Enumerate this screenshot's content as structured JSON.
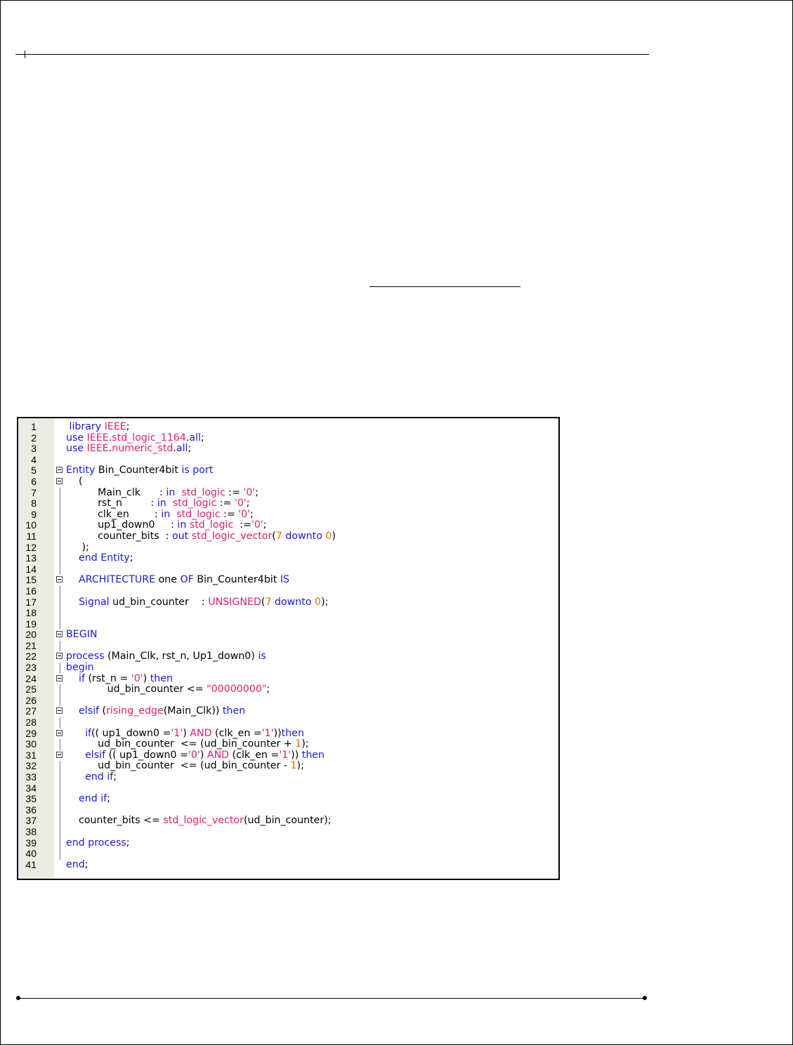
{
  "code_editor": {
    "lines": [
      {
        "n": "1",
        "fold": "",
        "tokens": [
          [
            "t",
            " "
          ],
          [
            "kw",
            "library"
          ],
          [
            "t",
            " "
          ],
          [
            "ty",
            "IEEE"
          ],
          [
            "t",
            ";"
          ]
        ]
      },
      {
        "n": "2",
        "fold": "",
        "tokens": [
          [
            "kw",
            "use"
          ],
          [
            "t",
            " "
          ],
          [
            "ty",
            "IEEE"
          ],
          [
            "t",
            "."
          ],
          [
            "ty",
            "std_logic_1164"
          ],
          [
            "t",
            "."
          ],
          [
            "kw",
            "all"
          ],
          [
            "t",
            ";"
          ]
        ]
      },
      {
        "n": "3",
        "fold": "",
        "tokens": [
          [
            "kw",
            "use"
          ],
          [
            "t",
            " "
          ],
          [
            "ty",
            "IEEE"
          ],
          [
            "t",
            "."
          ],
          [
            "ty",
            "numeric_std"
          ],
          [
            "t",
            "."
          ],
          [
            "kw",
            "all"
          ],
          [
            "t",
            ";"
          ]
        ]
      },
      {
        "n": "4",
        "fold": "",
        "tokens": []
      },
      {
        "n": "5",
        "fold": "box",
        "tokens": [
          [
            "kw",
            "Entity"
          ],
          [
            "t",
            " Bin_Counter4bit "
          ],
          [
            "kw",
            "is"
          ],
          [
            "t",
            " "
          ],
          [
            "kw",
            "port"
          ]
        ]
      },
      {
        "n": "6",
        "fold": "box",
        "tokens": [
          [
            "t",
            "    ("
          ]
        ]
      },
      {
        "n": "7",
        "fold": "bar",
        "tokens": [
          [
            "t",
            "          Main_clk      : "
          ],
          [
            "kw",
            "in"
          ],
          [
            "t",
            "  "
          ],
          [
            "ty",
            "std_logic"
          ],
          [
            "t",
            " := "
          ],
          [
            "str",
            "'0'"
          ],
          [
            "t",
            ";"
          ]
        ]
      },
      {
        "n": "8",
        "fold": "bar",
        "tokens": [
          [
            "t",
            "          rst_n         : "
          ],
          [
            "kw",
            "in"
          ],
          [
            "t",
            "  "
          ],
          [
            "ty",
            "std_logic"
          ],
          [
            "t",
            " := "
          ],
          [
            "str",
            "'0'"
          ],
          [
            "t",
            ";"
          ]
        ]
      },
      {
        "n": "9",
        "fold": "bar",
        "tokens": [
          [
            "t",
            "          clk_en        : "
          ],
          [
            "kw",
            "in"
          ],
          [
            "t",
            "  "
          ],
          [
            "ty",
            "std_logic"
          ],
          [
            "t",
            " := "
          ],
          [
            "str",
            "'0'"
          ],
          [
            "t",
            ";"
          ]
        ]
      },
      {
        "n": "10",
        "fold": "bar",
        "tokens": [
          [
            "t",
            "          up1_down0     : "
          ],
          [
            "kw",
            "in"
          ],
          [
            "t",
            " "
          ],
          [
            "ty",
            "std_logic"
          ],
          [
            "t",
            "  :="
          ],
          [
            "str",
            "'0'"
          ],
          [
            "t",
            ";"
          ]
        ]
      },
      {
        "n": "11",
        "fold": "bar",
        "tokens": [
          [
            "t",
            "          counter_bits  : "
          ],
          [
            "kw",
            "out"
          ],
          [
            "t",
            " "
          ],
          [
            "ty",
            "std_logic_vector"
          ],
          [
            "t",
            "("
          ],
          [
            "num",
            "7"
          ],
          [
            "t",
            " "
          ],
          [
            "kw",
            "downto"
          ],
          [
            "t",
            " "
          ],
          [
            "num",
            "0"
          ],
          [
            "t",
            ")"
          ]
        ]
      },
      {
        "n": "12",
        "fold": "bar",
        "tokens": [
          [
            "t",
            "     );"
          ]
        ]
      },
      {
        "n": "13",
        "fold": "bar",
        "tokens": [
          [
            "t",
            "    "
          ],
          [
            "kw",
            "end"
          ],
          [
            "t",
            " "
          ],
          [
            "kw",
            "Entity"
          ],
          [
            "t",
            ";"
          ]
        ]
      },
      {
        "n": "14",
        "fold": "bar",
        "tokens": []
      },
      {
        "n": "15",
        "fold": "box",
        "tokens": [
          [
            "t",
            "    "
          ],
          [
            "kw",
            "ARCHITECTURE"
          ],
          [
            "t",
            " one "
          ],
          [
            "kw",
            "OF"
          ],
          [
            "t",
            " Bin_Counter4bit "
          ],
          [
            "kw",
            "IS"
          ]
        ]
      },
      {
        "n": "16",
        "fold": "bar",
        "tokens": []
      },
      {
        "n": "17",
        "fold": "bar",
        "tokens": [
          [
            "t",
            "    "
          ],
          [
            "kw",
            "Signal"
          ],
          [
            "t",
            " ud_bin_counter    : "
          ],
          [
            "ty",
            "UNSIGNED"
          ],
          [
            "t",
            "("
          ],
          [
            "num",
            "7"
          ],
          [
            "t",
            " "
          ],
          [
            "kw",
            "downto"
          ],
          [
            "t",
            " "
          ],
          [
            "num",
            "0"
          ],
          [
            "t",
            ");"
          ]
        ]
      },
      {
        "n": "18",
        "fold": "bar",
        "tokens": []
      },
      {
        "n": "19",
        "fold": "bar",
        "tokens": []
      },
      {
        "n": "20",
        "fold": "box",
        "tokens": [
          [
            "kw",
            "BEGIN"
          ]
        ]
      },
      {
        "n": "21",
        "fold": "bar",
        "tokens": []
      },
      {
        "n": "22",
        "fold": "box",
        "tokens": [
          [
            "kw",
            "process"
          ],
          [
            "t",
            " (Main_Clk, rst_n, Up1_down0) "
          ],
          [
            "kw",
            "is"
          ]
        ]
      },
      {
        "n": "23",
        "fold": "bar",
        "tokens": [
          [
            "kw",
            "begin"
          ]
        ]
      },
      {
        "n": "24",
        "fold": "box",
        "tokens": [
          [
            "t",
            "    "
          ],
          [
            "kw",
            "if"
          ],
          [
            "t",
            " (rst_n = "
          ],
          [
            "str",
            "'0'"
          ],
          [
            "t",
            ") "
          ],
          [
            "kw",
            "then"
          ]
        ]
      },
      {
        "n": "25",
        "fold": "bar",
        "tokens": [
          [
            "t",
            "             ud_bin_counter <= "
          ],
          [
            "str",
            "\"00000000\""
          ],
          [
            "t",
            ";"
          ]
        ]
      },
      {
        "n": "26",
        "fold": "bar",
        "tokens": []
      },
      {
        "n": "27",
        "fold": "box",
        "tokens": [
          [
            "t",
            "    "
          ],
          [
            "kw",
            "elsif"
          ],
          [
            "t",
            " ("
          ],
          [
            "ty",
            "rising_edge"
          ],
          [
            "t",
            "(Main_Clk)) "
          ],
          [
            "kw",
            "then"
          ]
        ]
      },
      {
        "n": "28",
        "fold": "bar",
        "tokens": []
      },
      {
        "n": "29",
        "fold": "box",
        "tokens": [
          [
            "t",
            "      "
          ],
          [
            "kw",
            "if"
          ],
          [
            "t",
            "(( up1_down0 ="
          ],
          [
            "str",
            "'1'"
          ],
          [
            "t",
            ") "
          ],
          [
            "ty",
            "AND"
          ],
          [
            "t",
            " (clk_en ="
          ],
          [
            "str",
            "'1'"
          ],
          [
            "t",
            "))"
          ],
          [
            "kw",
            "then"
          ]
        ]
      },
      {
        "n": "30",
        "fold": "bar",
        "tokens": [
          [
            "t",
            "          ud_bin_counter  <= (ud_bin_counter + "
          ],
          [
            "num",
            "1"
          ],
          [
            "t",
            ");"
          ]
        ]
      },
      {
        "n": "31",
        "fold": "box",
        "tokens": [
          [
            "t",
            "      "
          ],
          [
            "kw",
            "elsif"
          ],
          [
            "t",
            " (( up1_down0 ="
          ],
          [
            "str",
            "'0'"
          ],
          [
            "t",
            ") "
          ],
          [
            "ty",
            "AND"
          ],
          [
            "t",
            " (clk_en ="
          ],
          [
            "str",
            "'1'"
          ],
          [
            "t",
            "))"
          ],
          [
            "t",
            " "
          ],
          [
            "kw",
            "then"
          ]
        ]
      },
      {
        "n": "32",
        "fold": "bar",
        "tokens": [
          [
            "t",
            "          ud_bin_counter  <= (ud_bin_counter - "
          ],
          [
            "num",
            "1"
          ],
          [
            "t",
            ");"
          ]
        ]
      },
      {
        "n": "33",
        "fold": "bar",
        "tokens": [
          [
            "t",
            "      "
          ],
          [
            "kw",
            "end"
          ],
          [
            "t",
            " "
          ],
          [
            "kw",
            "if"
          ],
          [
            "t",
            ";"
          ]
        ]
      },
      {
        "n": "34",
        "fold": "bar",
        "tokens": []
      },
      {
        "n": "35",
        "fold": "bar",
        "tokens": [
          [
            "t",
            "    "
          ],
          [
            "kw",
            "end"
          ],
          [
            "t",
            " "
          ],
          [
            "kw",
            "if"
          ],
          [
            "t",
            ";"
          ]
        ]
      },
      {
        "n": "36",
        "fold": "bar",
        "tokens": []
      },
      {
        "n": "37",
        "fold": "bar",
        "tokens": [
          [
            "t",
            "    counter_bits <= "
          ],
          [
            "ty",
            "std_logic_vector"
          ],
          [
            "t",
            "(ud_bin_counter);"
          ]
        ]
      },
      {
        "n": "38",
        "fold": "bar",
        "tokens": []
      },
      {
        "n": "39",
        "fold": "bar",
        "tokens": [
          [
            "kw",
            "end"
          ],
          [
            "t",
            " "
          ],
          [
            "kw",
            "process"
          ],
          [
            "t",
            ";"
          ]
        ]
      },
      {
        "n": "40",
        "fold": "bar",
        "tokens": []
      },
      {
        "n": "41",
        "fold": "",
        "tokens": [
          [
            "kw",
            "end"
          ],
          [
            "t",
            ";"
          ]
        ]
      }
    ]
  },
  "colors": {
    "keyword": "#1a1ad6",
    "type": "#e0206a",
    "number": "#f06a00",
    "gutter": "#ecece4"
  }
}
